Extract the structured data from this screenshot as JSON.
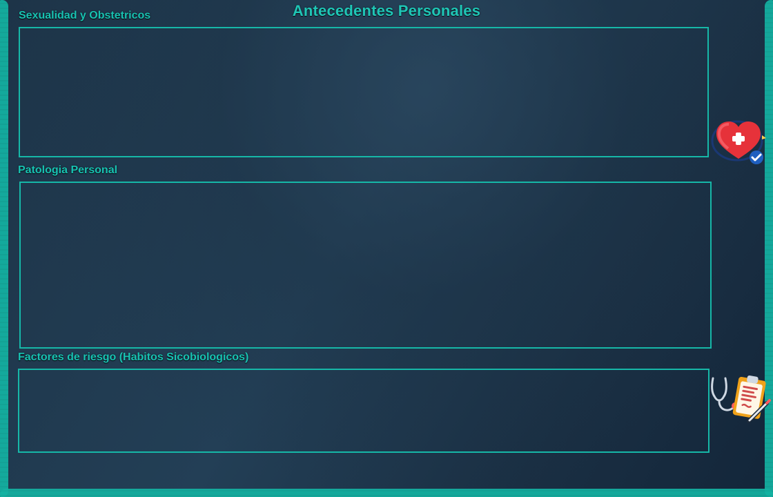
{
  "page": {
    "title": "Antecedentes Personales"
  },
  "sections": [
    {
      "label": "Sexualidad y Obstetricos"
    },
    {
      "label": "Patologia Personal"
    },
    {
      "label": "Factores de riesgo (Habitos Sicobiologicos)"
    }
  ],
  "icons": {
    "heart": "medical-heart-icon",
    "clipboard": "medical-clipboard-stethoscope-icon"
  },
  "colors": {
    "accent": "#16b8a8",
    "background_dark": "#13263a",
    "background_mid": "#1d3448"
  }
}
